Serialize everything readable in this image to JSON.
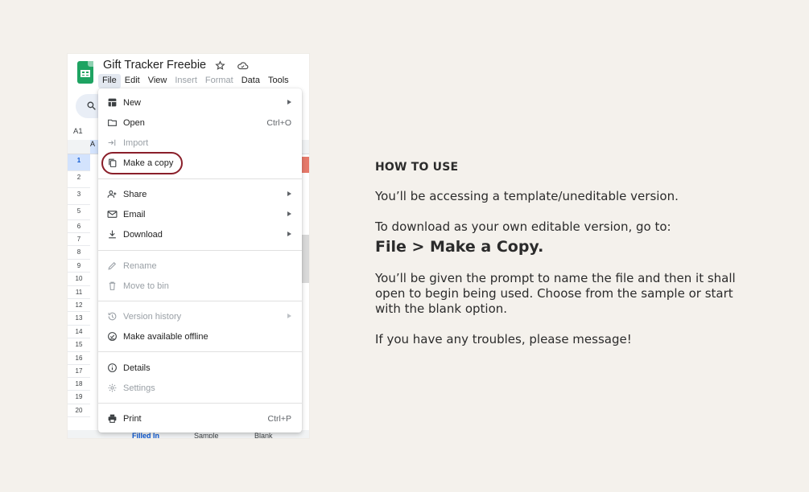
{
  "colors": {
    "background": "#f4f1ec",
    "highlight_ring": "#8a1f2a",
    "sheets_green": "#1ea362"
  },
  "app": {
    "doc_title": "Gift Tracker Freebie",
    "menu_bar": [
      {
        "label": "File",
        "active": true
      },
      {
        "label": "Edit"
      },
      {
        "label": "View"
      },
      {
        "label": "Insert",
        "disabled": true
      },
      {
        "label": "Format",
        "disabled": true
      },
      {
        "label": "Data"
      },
      {
        "label": "Tools"
      }
    ],
    "cell_ref": "A1",
    "column_header": "A",
    "row_numbers": [
      "1",
      "2",
      "3",
      "5",
      "6",
      "7",
      "8",
      "9",
      "10",
      "11",
      "12",
      "13",
      "14",
      "15",
      "16",
      "17",
      "18",
      "19",
      "20"
    ],
    "sheet_tabs": [
      "Filled In",
      "Sample",
      "Blank"
    ]
  },
  "file_menu": {
    "items": [
      {
        "label": "New",
        "icon": "new-sheet-icon",
        "submenu": true
      },
      {
        "label": "Open",
        "icon": "folder-icon",
        "shortcut": "Ctrl+O"
      },
      {
        "label": "Import",
        "icon": "import-icon",
        "disabled": true
      },
      {
        "label": "Make a copy",
        "icon": "copy-icon",
        "highlighted": true
      },
      {
        "label": "Share",
        "icon": "share-person-icon",
        "submenu": true
      },
      {
        "label": "Email",
        "icon": "email-icon",
        "submenu": true
      },
      {
        "label": "Download",
        "icon": "download-icon",
        "submenu": true
      },
      {
        "label": "Rename",
        "icon": "rename-icon",
        "disabled": true
      },
      {
        "label": "Move to bin",
        "icon": "bin-icon",
        "disabled": true
      },
      {
        "label": "Version history",
        "icon": "history-icon",
        "disabled": true,
        "submenu": true
      },
      {
        "label": "Make available offline",
        "icon": "offline-icon"
      },
      {
        "label": "Details",
        "icon": "info-icon"
      },
      {
        "label": "Settings",
        "icon": "settings-icon",
        "disabled": true
      },
      {
        "label": "Print",
        "icon": "print-icon",
        "shortcut": "Ctrl+P"
      }
    ]
  },
  "instructions": {
    "heading": "HOW TO USE",
    "p1": "You’ll be accessing a template/uneditable version.",
    "p2": "To download as your own editable version, go to:",
    "emphasis": "File > Make a Copy.",
    "p3": "You’ll be given the prompt to name the file and then it shall open to begin being used. Choose from the sample or start with the blank option.",
    "p4": "If you have any troubles, please message!"
  }
}
